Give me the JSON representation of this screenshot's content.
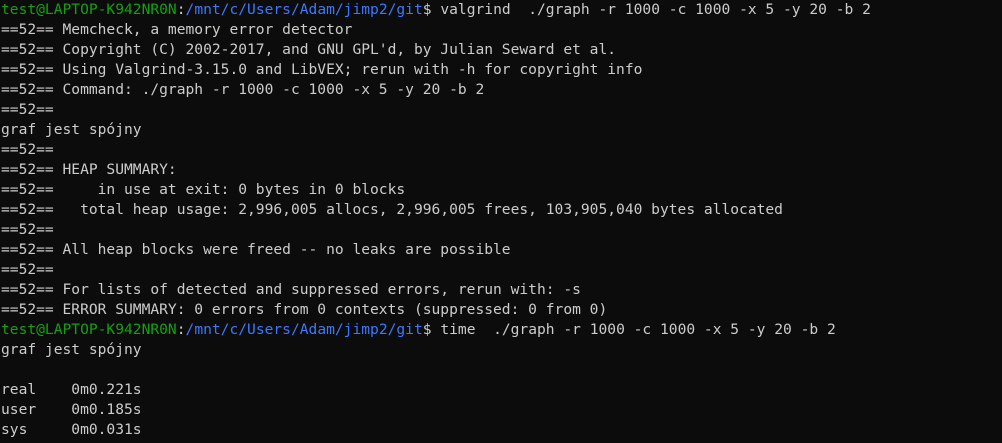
{
  "colors": {
    "background": "#0c0c0c",
    "foreground": "#cccccc",
    "prompt_user": "#13a10e",
    "prompt_path": "#3b78ff"
  },
  "prompt": {
    "user_host": "test@LAPTOP-K942NR0N",
    "separator": ":",
    "path": "/mnt/c/Users/Adam/jimp2/git",
    "symbol": "$"
  },
  "lines": [
    {
      "type": "prompt",
      "command": " valgrind  ./graph -r 1000 -c 1000 -x 5 -y 20 -b 2"
    },
    {
      "type": "output",
      "text": "==52== Memcheck, a memory error detector"
    },
    {
      "type": "output",
      "text": "==52== Copyright (C) 2002-2017, and GNU GPL'd, by Julian Seward et al."
    },
    {
      "type": "output",
      "text": "==52== Using Valgrind-3.15.0 and LibVEX; rerun with -h for copyright info"
    },
    {
      "type": "output",
      "text": "==52== Command: ./graph -r 1000 -c 1000 -x 5 -y 20 -b 2"
    },
    {
      "type": "output",
      "text": "==52=="
    },
    {
      "type": "output",
      "text": "graf jest spójny"
    },
    {
      "type": "output",
      "text": "==52=="
    },
    {
      "type": "output",
      "text": "==52== HEAP SUMMARY:"
    },
    {
      "type": "output",
      "text": "==52==     in use at exit: 0 bytes in 0 blocks"
    },
    {
      "type": "output",
      "text": "==52==   total heap usage: 2,996,005 allocs, 2,996,005 frees, 103,905,040 bytes allocated"
    },
    {
      "type": "output",
      "text": "==52=="
    },
    {
      "type": "output",
      "text": "==52== All heap blocks were freed -- no leaks are possible"
    },
    {
      "type": "output",
      "text": "==52=="
    },
    {
      "type": "output",
      "text": "==52== For lists of detected and suppressed errors, rerun with: -s"
    },
    {
      "type": "output",
      "text": "==52== ERROR SUMMARY: 0 errors from 0 contexts (suppressed: 0 from 0)"
    },
    {
      "type": "prompt",
      "command": " time  ./graph -r 1000 -c 1000 -x 5 -y 20 -b 2"
    },
    {
      "type": "output",
      "text": "graf jest spójny"
    },
    {
      "type": "output",
      "text": ""
    },
    {
      "type": "output",
      "text": "real    0m0.221s"
    },
    {
      "type": "output",
      "text": "user    0m0.185s"
    },
    {
      "type": "output",
      "text": "sys     0m0.031s"
    }
  ]
}
